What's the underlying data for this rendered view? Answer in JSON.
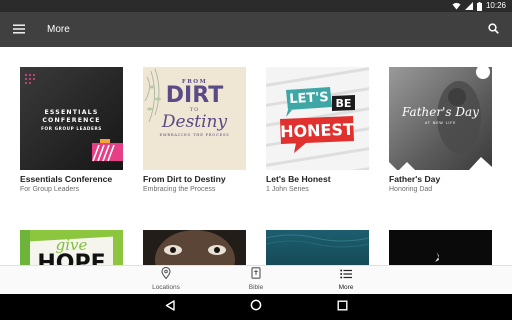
{
  "status_bar": {
    "time": "10:26"
  },
  "app_bar": {
    "title": "More"
  },
  "series": [
    {
      "title": "Essentials Conference",
      "subtitle": "For Group Leaders",
      "art": {
        "line1": "ESSENTIALS",
        "line2": "CONFERENCE",
        "line3": "FOR GROUP LEADERS"
      }
    },
    {
      "title": "From Dirt to Destiny",
      "subtitle": "Embracing the Process",
      "art": {
        "line1": "FROM",
        "line2": "DIRT",
        "line3": "TO",
        "line4": "Destiny",
        "line5": "EMBRACING THE PROCESS"
      }
    },
    {
      "title": "Let's Be Honest",
      "subtitle": "1 John Series",
      "art": {
        "line1": "LET'S",
        "line2": "BE",
        "line3": "HONEST"
      }
    },
    {
      "title": "Father's Day",
      "subtitle": "Honoring Dad",
      "art": {
        "line1": "Father's Day",
        "line2": "AT NEW LIFE"
      }
    },
    {
      "art": {
        "line1": "give",
        "line2": "HOPE"
      }
    },
    {
      "art": {}
    },
    {
      "art": {}
    },
    {
      "art": {}
    }
  ],
  "bottom_nav": {
    "items": [
      {
        "label": "Locations",
        "icon": "location-pin-icon"
      },
      {
        "label": "Bible",
        "icon": "bible-icon"
      },
      {
        "label": "More",
        "icon": "list-icon"
      }
    ]
  },
  "colors": {
    "app_bar": "#404040",
    "status_bar": "#2b2b2b",
    "honest_red": "#e0312f",
    "honest_teal": "#3fa6a6"
  }
}
